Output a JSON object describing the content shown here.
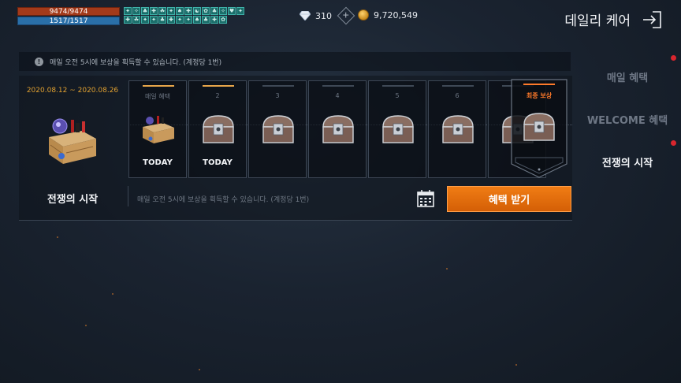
{
  "status": {
    "hp": "9474/9474",
    "mp": "1517/1517"
  },
  "buffs": [
    "✦",
    "✧",
    "♣",
    "✚",
    "☘",
    "✦",
    "♠",
    "✚",
    "☯",
    "✿",
    "♣",
    "✧",
    "♥",
    "✦",
    "✚",
    "☘",
    "✦",
    "✦",
    "♣",
    "✚",
    "✦",
    "✦",
    "♠",
    "♣",
    "✚",
    "✿"
  ],
  "currency": {
    "diamond": "310",
    "gold": "9,720,549"
  },
  "header": {
    "title": "데일리 케어"
  },
  "notice": "매일 오전 5시에 보상을 획득할 수 있습니다. (계정당 1번)",
  "event": {
    "date_range": "2020.08.12 ~ 2020.08.26",
    "name": "전쟁의 시작",
    "bottom_notice": "매일 오전 5시에 보상을 획득할 수 있습니다. (계정당 1번)",
    "claim_label": "혜택 받기"
  },
  "slots": [
    {
      "label": "매일 혜택",
      "today": "TODAY",
      "claimed": true,
      "icon": "chest-gift-box"
    },
    {
      "label": "2",
      "today": "TODAY",
      "claimed": true,
      "icon": "silver-chest"
    },
    {
      "label": "3",
      "today": "",
      "claimed": false,
      "icon": "silver-chest"
    },
    {
      "label": "4",
      "today": "",
      "claimed": false,
      "icon": "silver-chest"
    },
    {
      "label": "5",
      "today": "",
      "claimed": false,
      "icon": "silver-chest"
    },
    {
      "label": "6",
      "today": "",
      "claimed": false,
      "icon": "silver-chest"
    }
  ],
  "final_reward": {
    "label": "최종 보상"
  },
  "sidebar": {
    "items": [
      {
        "label": "매일 혜택",
        "active": false,
        "dot": true
      },
      {
        "label": "WELCOME 혜택",
        "active": false,
        "dot": false
      },
      {
        "label": "전쟁의 시작",
        "active": true,
        "dot": true
      }
    ]
  },
  "colors": {
    "accent": "#e7770f",
    "date": "#e0a030",
    "final_label": "#ff7a2a",
    "notification": "#d9262e"
  }
}
